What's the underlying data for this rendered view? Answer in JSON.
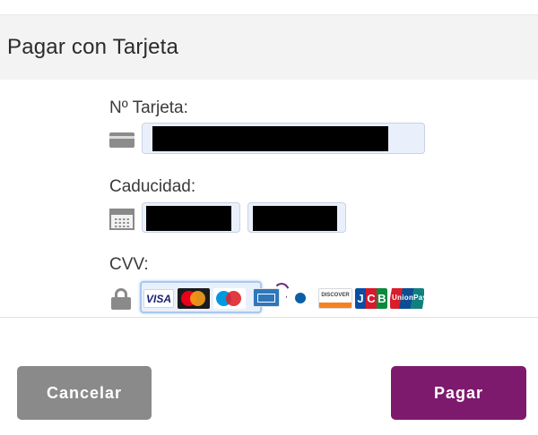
{
  "colors": {
    "header_bg": "#f3f3f3",
    "field_bg": "#eaf0fb",
    "cancel_button": "#8a8a8a",
    "pay_button": "#7e1a6e",
    "masked_value": "#000000"
  },
  "header": {
    "title": "Pagar con Tarjeta"
  },
  "form": {
    "card_number": {
      "label": "Nº Tarjeta:",
      "icon": "credit-card-icon",
      "value": ""
    },
    "expiry": {
      "label": "Caducidad:",
      "icon": "calendar-icon",
      "month_value": "",
      "year_value": ""
    },
    "cvv": {
      "label": "CVV:",
      "icon": "lock-icon",
      "value": "",
      "card_brands": [
        "Visa",
        "Mastercard",
        "Maestro",
        "American Express",
        "Diners Club",
        "Discover",
        "JCB",
        "UnionPay"
      ],
      "visa_text": "VISA",
      "discover_text": "DISCOVER",
      "jcb_letters": [
        "J",
        "C",
        "B"
      ],
      "unionpay_text": "UnionPay"
    }
  },
  "actions": {
    "cancel_label": "Cancelar",
    "pay_label": "Pagar"
  }
}
